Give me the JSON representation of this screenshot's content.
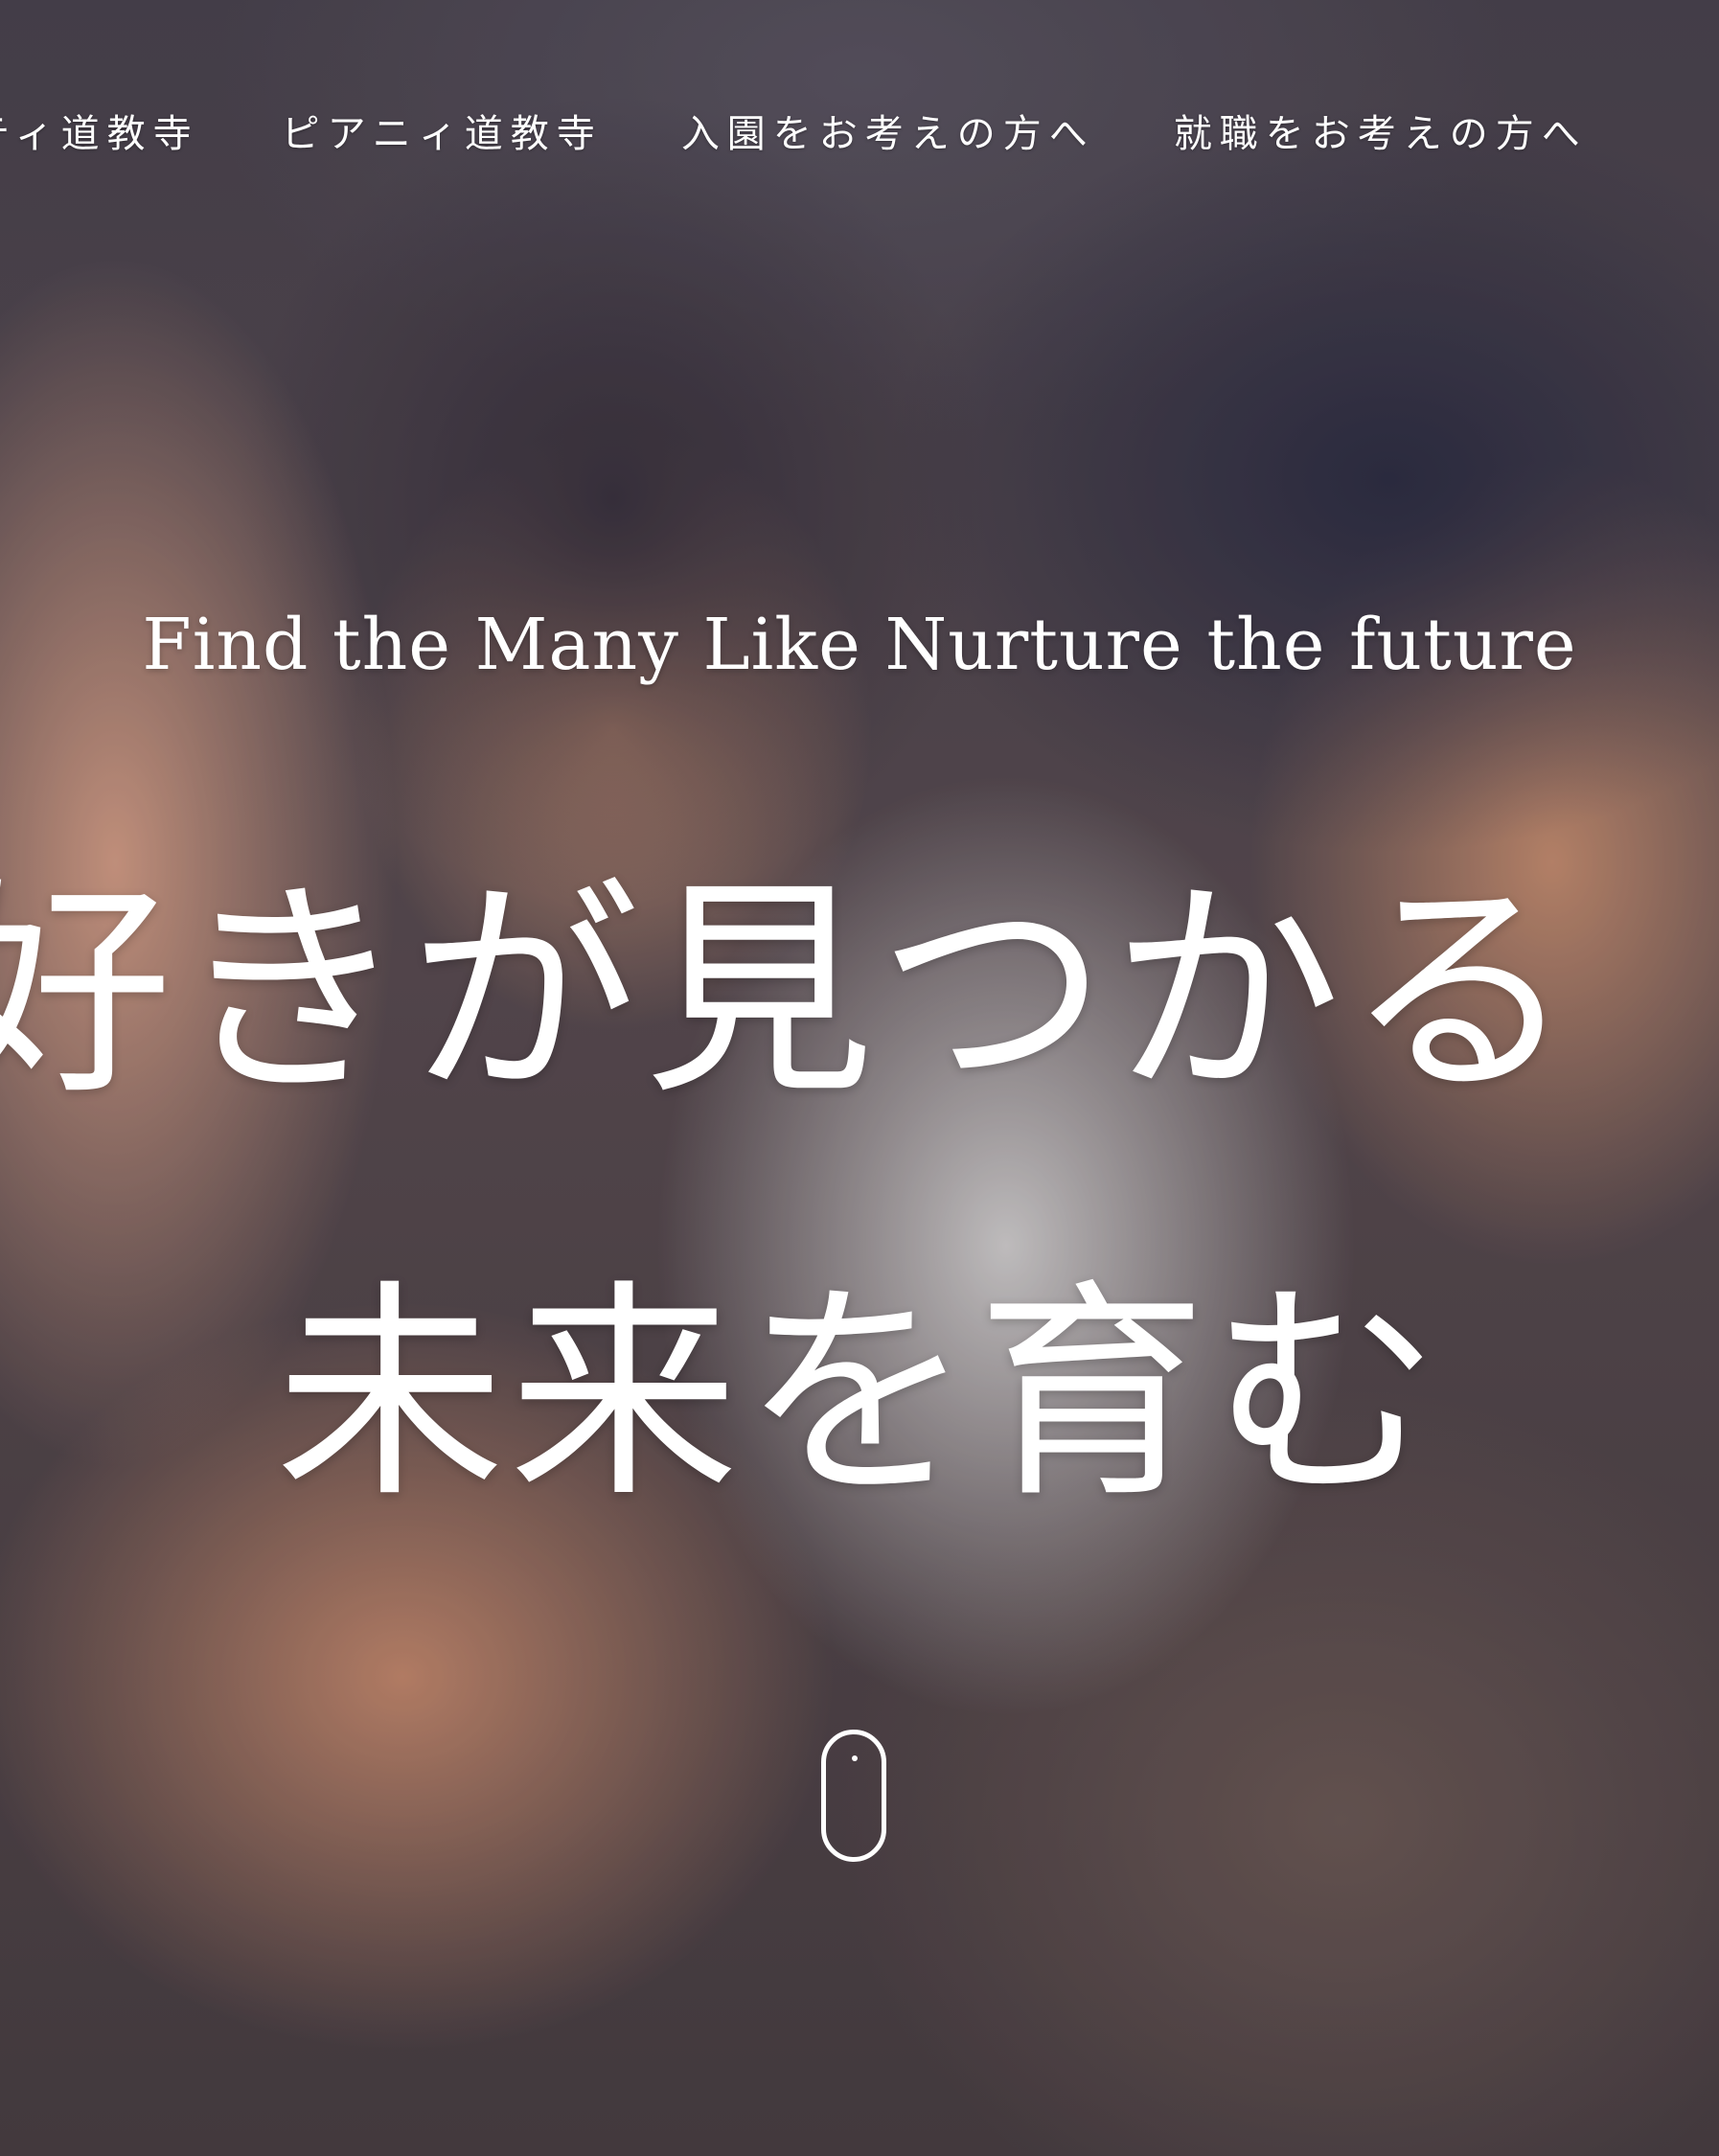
{
  "nav": {
    "items": [
      {
        "label": "ティ道教寺"
      },
      {
        "label": "ピアニィ道教寺"
      },
      {
        "label": "入園をお考えの方へ"
      },
      {
        "label": "就職をお考えの方へ"
      }
    ]
  },
  "hero": {
    "tagline": "Find the Many Like Nurture the future",
    "headline_line1": "好きが見つかる",
    "headline_line2": "未来を育む"
  },
  "colors": {
    "text": "#ffffff"
  },
  "icons": {
    "scroll": "mouse-scroll-icon"
  }
}
